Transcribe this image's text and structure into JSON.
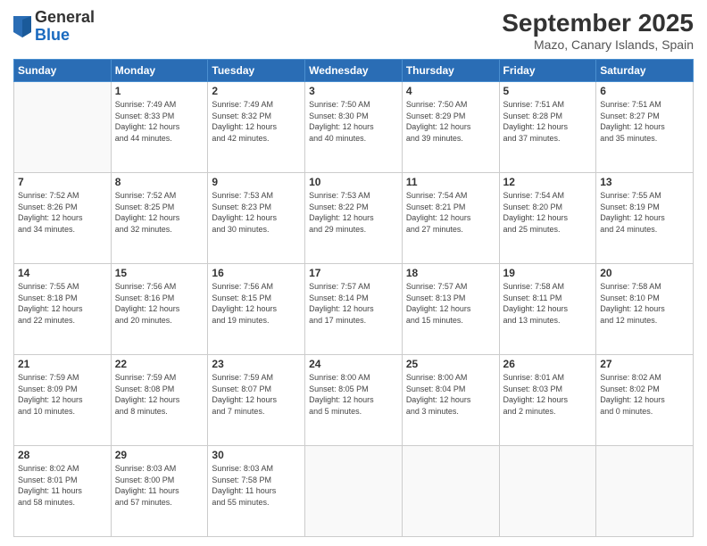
{
  "logo": {
    "general": "General",
    "blue": "Blue"
  },
  "header": {
    "month": "September 2025",
    "location": "Mazo, Canary Islands, Spain"
  },
  "days_of_week": [
    "Sunday",
    "Monday",
    "Tuesday",
    "Wednesday",
    "Thursday",
    "Friday",
    "Saturday"
  ],
  "weeks": [
    [
      {
        "day": "",
        "info": ""
      },
      {
        "day": "1",
        "info": "Sunrise: 7:49 AM\nSunset: 8:33 PM\nDaylight: 12 hours\nand 44 minutes."
      },
      {
        "day": "2",
        "info": "Sunrise: 7:49 AM\nSunset: 8:32 PM\nDaylight: 12 hours\nand 42 minutes."
      },
      {
        "day": "3",
        "info": "Sunrise: 7:50 AM\nSunset: 8:30 PM\nDaylight: 12 hours\nand 40 minutes."
      },
      {
        "day": "4",
        "info": "Sunrise: 7:50 AM\nSunset: 8:29 PM\nDaylight: 12 hours\nand 39 minutes."
      },
      {
        "day": "5",
        "info": "Sunrise: 7:51 AM\nSunset: 8:28 PM\nDaylight: 12 hours\nand 37 minutes."
      },
      {
        "day": "6",
        "info": "Sunrise: 7:51 AM\nSunset: 8:27 PM\nDaylight: 12 hours\nand 35 minutes."
      }
    ],
    [
      {
        "day": "7",
        "info": "Sunrise: 7:52 AM\nSunset: 8:26 PM\nDaylight: 12 hours\nand 34 minutes."
      },
      {
        "day": "8",
        "info": "Sunrise: 7:52 AM\nSunset: 8:25 PM\nDaylight: 12 hours\nand 32 minutes."
      },
      {
        "day": "9",
        "info": "Sunrise: 7:53 AM\nSunset: 8:23 PM\nDaylight: 12 hours\nand 30 minutes."
      },
      {
        "day": "10",
        "info": "Sunrise: 7:53 AM\nSunset: 8:22 PM\nDaylight: 12 hours\nand 29 minutes."
      },
      {
        "day": "11",
        "info": "Sunrise: 7:54 AM\nSunset: 8:21 PM\nDaylight: 12 hours\nand 27 minutes."
      },
      {
        "day": "12",
        "info": "Sunrise: 7:54 AM\nSunset: 8:20 PM\nDaylight: 12 hours\nand 25 minutes."
      },
      {
        "day": "13",
        "info": "Sunrise: 7:55 AM\nSunset: 8:19 PM\nDaylight: 12 hours\nand 24 minutes."
      }
    ],
    [
      {
        "day": "14",
        "info": "Sunrise: 7:55 AM\nSunset: 8:18 PM\nDaylight: 12 hours\nand 22 minutes."
      },
      {
        "day": "15",
        "info": "Sunrise: 7:56 AM\nSunset: 8:16 PM\nDaylight: 12 hours\nand 20 minutes."
      },
      {
        "day": "16",
        "info": "Sunrise: 7:56 AM\nSunset: 8:15 PM\nDaylight: 12 hours\nand 19 minutes."
      },
      {
        "day": "17",
        "info": "Sunrise: 7:57 AM\nSunset: 8:14 PM\nDaylight: 12 hours\nand 17 minutes."
      },
      {
        "day": "18",
        "info": "Sunrise: 7:57 AM\nSunset: 8:13 PM\nDaylight: 12 hours\nand 15 minutes."
      },
      {
        "day": "19",
        "info": "Sunrise: 7:58 AM\nSunset: 8:11 PM\nDaylight: 12 hours\nand 13 minutes."
      },
      {
        "day": "20",
        "info": "Sunrise: 7:58 AM\nSunset: 8:10 PM\nDaylight: 12 hours\nand 12 minutes."
      }
    ],
    [
      {
        "day": "21",
        "info": "Sunrise: 7:59 AM\nSunset: 8:09 PM\nDaylight: 12 hours\nand 10 minutes."
      },
      {
        "day": "22",
        "info": "Sunrise: 7:59 AM\nSunset: 8:08 PM\nDaylight: 12 hours\nand 8 minutes."
      },
      {
        "day": "23",
        "info": "Sunrise: 7:59 AM\nSunset: 8:07 PM\nDaylight: 12 hours\nand 7 minutes."
      },
      {
        "day": "24",
        "info": "Sunrise: 8:00 AM\nSunset: 8:05 PM\nDaylight: 12 hours\nand 5 minutes."
      },
      {
        "day": "25",
        "info": "Sunrise: 8:00 AM\nSunset: 8:04 PM\nDaylight: 12 hours\nand 3 minutes."
      },
      {
        "day": "26",
        "info": "Sunrise: 8:01 AM\nSunset: 8:03 PM\nDaylight: 12 hours\nand 2 minutes."
      },
      {
        "day": "27",
        "info": "Sunrise: 8:02 AM\nSunset: 8:02 PM\nDaylight: 12 hours\nand 0 minutes."
      }
    ],
    [
      {
        "day": "28",
        "info": "Sunrise: 8:02 AM\nSunset: 8:01 PM\nDaylight: 11 hours\nand 58 minutes."
      },
      {
        "day": "29",
        "info": "Sunrise: 8:03 AM\nSunset: 8:00 PM\nDaylight: 11 hours\nand 57 minutes."
      },
      {
        "day": "30",
        "info": "Sunrise: 8:03 AM\nSunset: 7:58 PM\nDaylight: 11 hours\nand 55 minutes."
      },
      {
        "day": "",
        "info": ""
      },
      {
        "day": "",
        "info": ""
      },
      {
        "day": "",
        "info": ""
      },
      {
        "day": "",
        "info": ""
      }
    ]
  ]
}
